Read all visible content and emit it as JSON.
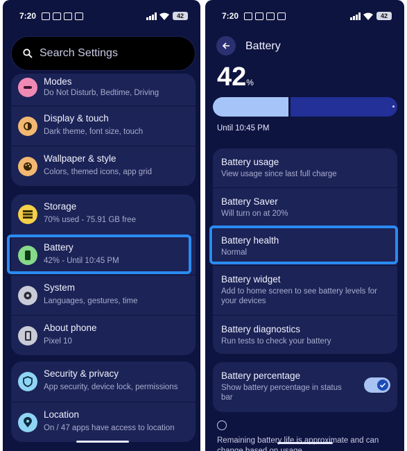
{
  "statusbar": {
    "time": "7:20",
    "battery": "42"
  },
  "left": {
    "search_placeholder": "Search Settings",
    "items": [
      {
        "title": "Modes",
        "sub": "Do Not Disturb, Bedtime, Driving",
        "icon": "modes-icon",
        "color": "#f08ab5"
      },
      {
        "title": "Display & touch",
        "sub": "Dark theme, font size, touch",
        "icon": "brightness-icon",
        "color": "#f2b872"
      },
      {
        "title": "Wallpaper & style",
        "sub": "Colors, themed icons, app grid",
        "icon": "palette-icon",
        "color": "#f2b872"
      },
      {
        "title": "Storage",
        "sub": "70% used - 75.91 GB free",
        "icon": "storage-icon",
        "color": "#f3cf4a"
      },
      {
        "title": "Battery",
        "sub": "42% - Until 10:45 PM",
        "icon": "battery-icon",
        "color": "#86d98a"
      },
      {
        "title": "System",
        "sub": "Languages, gestures, time",
        "icon": "gear-icon",
        "color": "#c9cbd6"
      },
      {
        "title": "About phone",
        "sub": "Pixel 10",
        "icon": "phone-icon",
        "color": "#c9cbd6"
      },
      {
        "title": "Security & privacy",
        "sub": "App security, device lock, permissions",
        "icon": "shield-icon",
        "color": "#8fd4f5"
      },
      {
        "title": "Location",
        "sub": "On / 47 apps have access to location",
        "icon": "location-icon",
        "color": "#8fd4f5"
      }
    ]
  },
  "right": {
    "title": "Battery",
    "percent": "42",
    "percent_unit": "%",
    "level": 0.42,
    "until": "Until 10:45 PM",
    "items": [
      {
        "title": "Battery usage",
        "sub": "View usage since last full charge"
      },
      {
        "title": "Battery Saver",
        "sub": "Will turn on at 20%"
      },
      {
        "title": "Battery health",
        "sub": "Normal"
      },
      {
        "title": "Battery widget",
        "sub": "Add to home screen to see battery levels for your devices"
      },
      {
        "title": "Battery diagnostics",
        "sub": "Run tests to check your battery"
      }
    ],
    "percentage_toggle": {
      "title": "Battery percentage",
      "sub": "Show battery percentage in status bar",
      "on": true
    },
    "note": "Remaining battery life is approximate and can change based on usage"
  },
  "colors": {
    "background": "#0e1440",
    "card": "#1c2356",
    "highlight": "#2a8bf2"
  }
}
